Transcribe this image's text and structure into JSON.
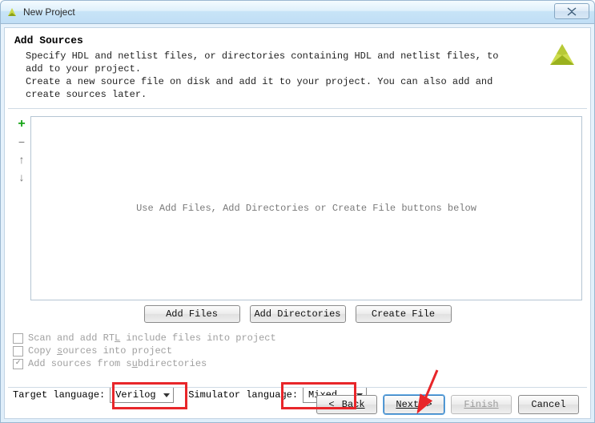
{
  "window": {
    "title": "New Project"
  },
  "header": {
    "title": "Add Sources",
    "desc": "Specify HDL and netlist files, or directories containing HDL and netlist files, to add to your project.\nCreate a new source file on disk and add it to your project. You can also add and create sources later."
  },
  "toolbar_icons": {
    "add": "add-icon",
    "remove": "minus-icon",
    "up": "arrow-up-icon",
    "down": "arrow-down-icon"
  },
  "source_list": {
    "empty_text": "Use Add Files, Add Directories or Create File buttons below"
  },
  "buttons": {
    "add_files": "Add Files",
    "add_dirs": "Add Directories",
    "create_file": "Create File"
  },
  "checkboxes": {
    "scan": {
      "label_pre": "Scan and add RT",
      "ul": "L",
      "label_post": " include files into project",
      "checked": false,
      "enabled": false
    },
    "copy": {
      "label_pre": "Copy ",
      "ul": "s",
      "label_post": "ources into project",
      "checked": false,
      "enabled": false
    },
    "subs": {
      "label_pre": "Add sources from s",
      "ul": "u",
      "label_post": "bdirectories",
      "checked": true,
      "enabled": false
    }
  },
  "language": {
    "target_label_pre": "Target language:",
    "target_value": "Verilog",
    "sim_label_pre": "Simulator language:",
    "sim_value": "Mixed"
  },
  "wizard": {
    "back": "Back",
    "next": "Next",
    "finish": "Finish",
    "cancel": "Cancel"
  }
}
